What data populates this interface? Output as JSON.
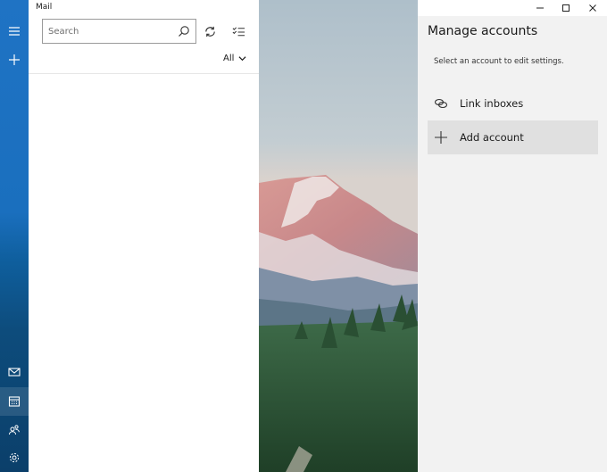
{
  "app": {
    "title": "Mail"
  },
  "rail": {
    "items": [
      {
        "icon": "hamburger-icon"
      },
      {
        "icon": "new-mail-plus-icon"
      },
      {
        "icon": "mail-icon"
      },
      {
        "icon": "calendar-icon"
      },
      {
        "icon": "people-icon"
      },
      {
        "icon": "settings-gear-icon"
      }
    ]
  },
  "search": {
    "placeholder": "Search",
    "value": ""
  },
  "toolbar": {
    "sync_icon": "sync-icon",
    "select_icon": "selection-mode-icon"
  },
  "filter": {
    "label": "All"
  },
  "flyout": {
    "title": "Manage accounts",
    "subtitle": "Select an account to edit settings.",
    "items": [
      {
        "label": "Link inboxes",
        "icon": "link-icon"
      },
      {
        "label": "Add account",
        "icon": "plus-icon"
      }
    ]
  },
  "colors": {
    "rail": "#1a6fbe",
    "flyout_bg": "#f2f2f2",
    "hover": "#e0e0e0"
  }
}
